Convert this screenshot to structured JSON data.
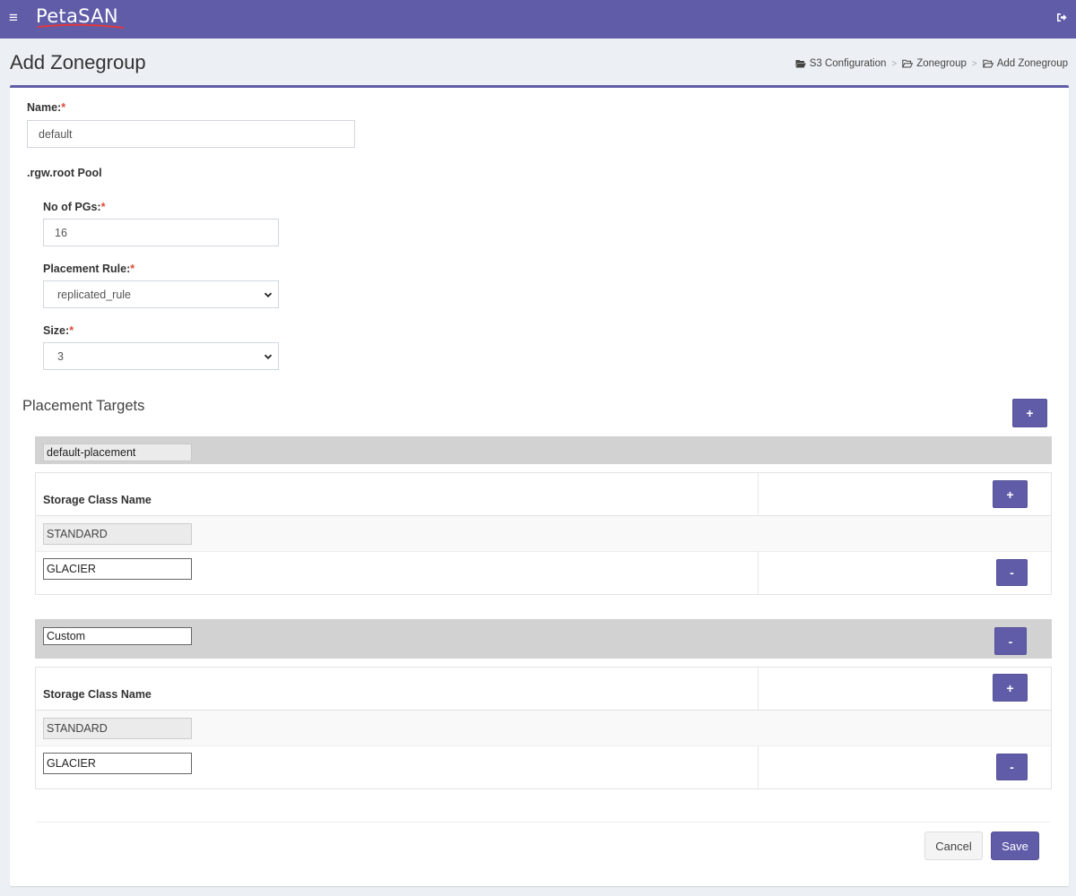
{
  "app": {
    "logo_text": "PetaSAN",
    "brand_color": "#605ca8"
  },
  "header": {
    "menu_icon": "hamburger-icon",
    "logout_icon": "sign-out-icon"
  },
  "page": {
    "title": "Add Zonegroup"
  },
  "breadcrumb": [
    {
      "label": "S3 Configuration",
      "icon": "folder-open-icon"
    },
    {
      "label": "Zonegroup",
      "icon": "folder-open-outline-icon"
    },
    {
      "label": "Add Zonegroup",
      "icon": "folder-open-outline-icon"
    }
  ],
  "breadcrumb_separator": ">",
  "form": {
    "required_mark": "*",
    "name": {
      "label": "Name:",
      "value": "default"
    },
    "root_pool_heading": ".rgw.root Pool",
    "pgs": {
      "label": "No of PGs:",
      "value": "16"
    },
    "placement_rule": {
      "label": "Placement Rule:",
      "value": "replicated_rule"
    },
    "size": {
      "label": "Size:",
      "value": "3"
    }
  },
  "placement_targets": {
    "title": "Placement Targets",
    "add_label": "+",
    "remove_label": "-",
    "groups": [
      {
        "name": "default-placement",
        "storage_class_header": "Storage Class Name",
        "storage_classes": [
          "STANDARD",
          "GLACIER"
        ]
      },
      {
        "name": "Custom",
        "storage_class_header": "Storage Class Name",
        "storage_classes": [
          "STANDARD",
          "GLACIER"
        ]
      }
    ]
  },
  "actions": {
    "cancel": "Cancel",
    "save": "Save"
  }
}
